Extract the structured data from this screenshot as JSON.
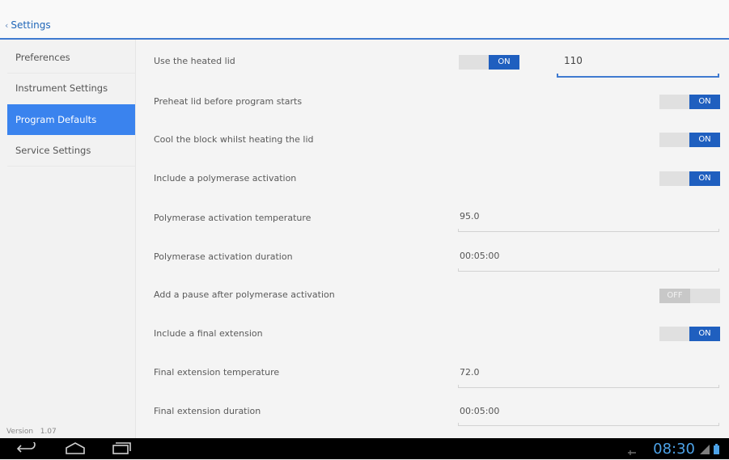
{
  "header": {
    "back_label": "Settings"
  },
  "sidebar": {
    "items": [
      {
        "label": "Preferences"
      },
      {
        "label": "Instrument Settings"
      },
      {
        "label": "Program Defaults"
      },
      {
        "label": "Service Settings"
      }
    ],
    "version_label": "Version",
    "version_value": "1.07"
  },
  "settings": {
    "heated_lid": {
      "label": "Use the heated lid",
      "toggle": "ON",
      "value": "110"
    },
    "preheat_lid": {
      "label": "Preheat lid before program starts",
      "toggle": "ON"
    },
    "cool_block": {
      "label": "Cool the block whilst heating the lid",
      "toggle": "ON"
    },
    "polymerase_activation": {
      "label": "Include a polymerase activation",
      "toggle": "ON"
    },
    "polymerase_temp": {
      "label": "Polymerase activation temperature",
      "value": "95.0"
    },
    "polymerase_duration": {
      "label": "Polymerase activation duration",
      "value": "00:05:00"
    },
    "pause_after": {
      "label": "Add a pause after polymerase activation",
      "toggle": "OFF"
    },
    "final_extension": {
      "label": "Include a final extension",
      "toggle": "ON"
    },
    "final_ext_temp": {
      "label": "Final extension temperature",
      "value": "72.0"
    },
    "final_ext_duration": {
      "label": "Final extension duration",
      "value": "00:05:00"
    }
  },
  "statusbar": {
    "time": "08:30"
  },
  "colors": {
    "accent": "#3a83ee",
    "toggle_on": "#1f5fbf",
    "clock": "#4da3e8"
  }
}
